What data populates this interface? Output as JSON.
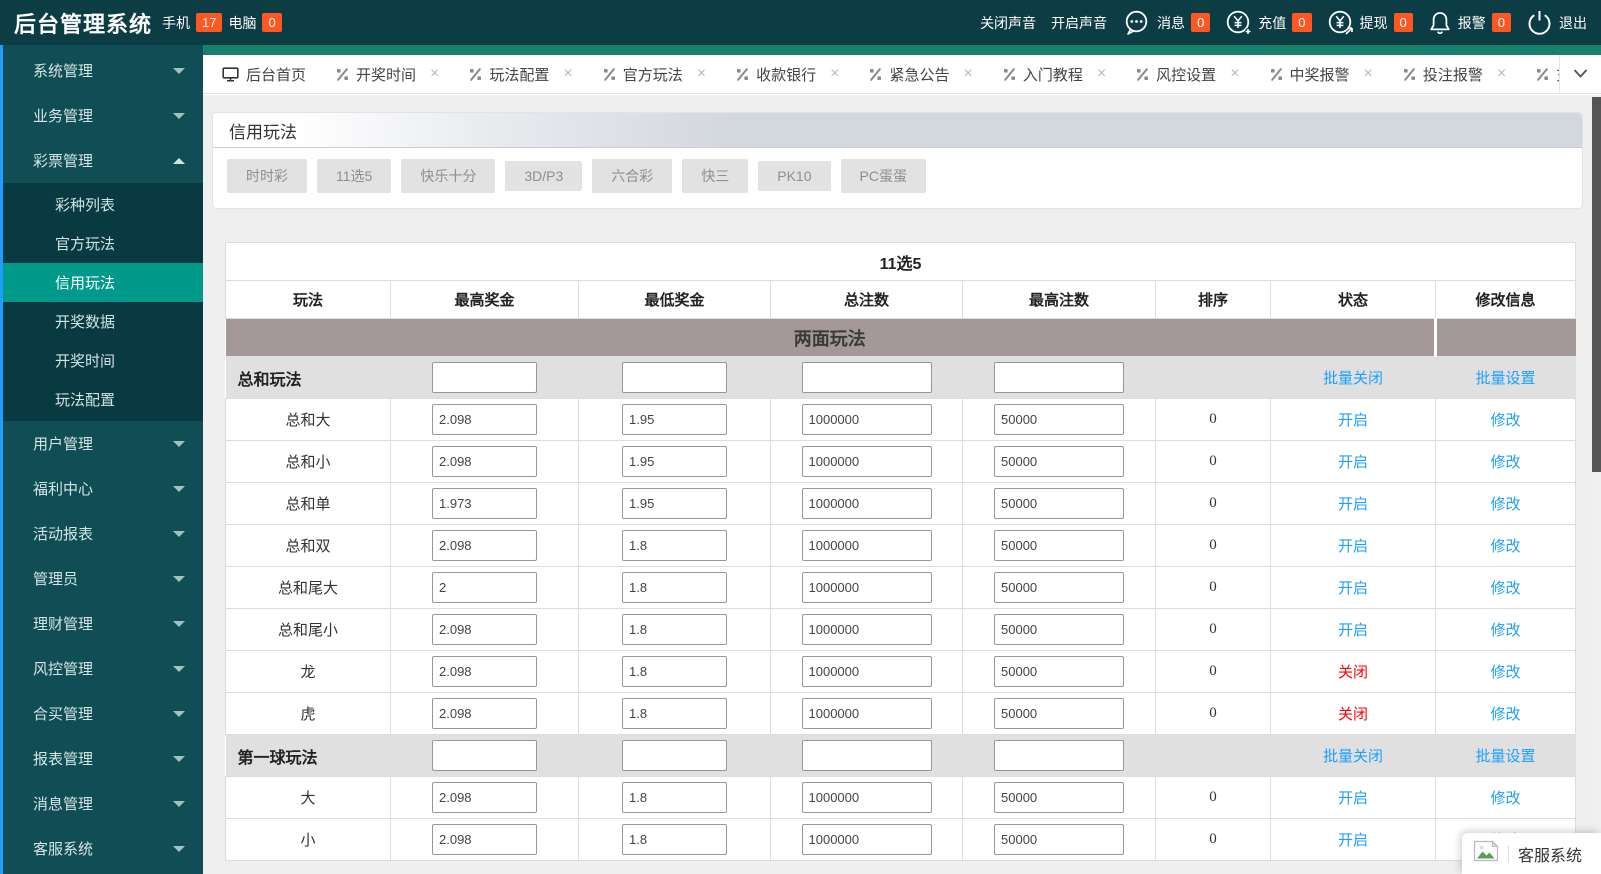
{
  "topbar": {
    "title": "后台管理系统",
    "phone_label": "手机",
    "phone_badge": "17",
    "pc_label": "电脑",
    "pc_badge": "0",
    "sound_off_label": "关闭声音",
    "sound_on_label": "开启声音",
    "message_label": "消息",
    "message_badge": "0",
    "recharge_label": "充值",
    "recharge_badge": "0",
    "withdraw_label": "提现",
    "withdraw_badge": "0",
    "alarm_label": "报警",
    "alarm_badge": "0",
    "logout_label": "退出"
  },
  "tabs": [
    {
      "label": "后台首页",
      "icon": "monitor-icon",
      "closable": false
    },
    {
      "label": "开奖时间",
      "icon": "percent-icon",
      "closable": true
    },
    {
      "label": "玩法配置",
      "icon": "percent-icon",
      "closable": true
    },
    {
      "label": "官方玩法",
      "icon": "percent-icon",
      "closable": true
    },
    {
      "label": "收款银行",
      "icon": "percent-icon",
      "closable": true
    },
    {
      "label": "紧急公告",
      "icon": "percent-icon",
      "closable": true
    },
    {
      "label": "入门教程",
      "icon": "percent-icon",
      "closable": true
    },
    {
      "label": "风控设置",
      "icon": "percent-icon",
      "closable": true
    },
    {
      "label": "中奖报警",
      "icon": "percent-icon",
      "closable": true
    },
    {
      "label": "投注报警",
      "icon": "percent-icon",
      "closable": true
    },
    {
      "label": "充值",
      "icon": "percent-icon",
      "closable": false
    }
  ],
  "sidebar": {
    "items": [
      {
        "label": "系统管理",
        "state": "collapsed"
      },
      {
        "label": "业务管理",
        "state": "collapsed"
      },
      {
        "label": "彩票管理",
        "state": "expanded",
        "children": [
          {
            "label": "彩种列表",
            "active": false
          },
          {
            "label": "官方玩法",
            "active": false
          },
          {
            "label": "信用玩法",
            "active": true
          },
          {
            "label": "开奖数据",
            "active": false
          },
          {
            "label": "开奖时间",
            "active": false
          },
          {
            "label": "玩法配置",
            "active": false
          }
        ]
      },
      {
        "label": "用户管理",
        "state": "collapsed"
      },
      {
        "label": "福利中心",
        "state": "collapsed"
      },
      {
        "label": "活动报表",
        "state": "collapsed"
      },
      {
        "label": "管理员",
        "state": "collapsed"
      },
      {
        "label": "理财管理",
        "state": "collapsed"
      },
      {
        "label": "风控管理",
        "state": "collapsed"
      },
      {
        "label": "合买管理",
        "state": "collapsed"
      },
      {
        "label": "报表管理",
        "state": "collapsed"
      },
      {
        "label": "消息管理",
        "state": "collapsed"
      },
      {
        "label": "客服系统",
        "state": "collapsed"
      }
    ]
  },
  "panel": {
    "title": "信用玩法",
    "game_tabs": [
      "时时彩",
      "11选5",
      "快乐十分",
      "3D/P3",
      "六合彩",
      "快三",
      "PK10",
      "PC蛋蛋"
    ]
  },
  "table": {
    "title": "11选5",
    "headers": [
      "玩法",
      "最高奖金",
      "最低奖金",
      "总注数",
      "最高注数",
      "排序",
      "状态",
      "修改信息"
    ],
    "rows": [
      {
        "type": "section",
        "label": "两面玩法"
      },
      {
        "type": "group",
        "label": "总和玩法",
        "inputs": [
          "",
          "",
          "",
          ""
        ],
        "batch_close": "批量关闭",
        "batch_set": "批量设置"
      },
      {
        "type": "data",
        "label": "总和大",
        "max_prize": "2.098",
        "min_prize": "1.95",
        "total_bets": "1000000",
        "max_bets": "50000",
        "sort": "0",
        "status": "开启",
        "status_state": "on",
        "edit": "修改"
      },
      {
        "type": "data",
        "label": "总和小",
        "max_prize": "2.098",
        "min_prize": "1.95",
        "total_bets": "1000000",
        "max_bets": "50000",
        "sort": "0",
        "status": "开启",
        "status_state": "on",
        "edit": "修改"
      },
      {
        "type": "data",
        "label": "总和单",
        "max_prize": "1.973",
        "min_prize": "1.95",
        "total_bets": "1000000",
        "max_bets": "50000",
        "sort": "0",
        "status": "开启",
        "status_state": "on",
        "edit": "修改"
      },
      {
        "type": "data",
        "label": "总和双",
        "max_prize": "2.098",
        "min_prize": "1.8",
        "total_bets": "1000000",
        "max_bets": "50000",
        "sort": "0",
        "status": "开启",
        "status_state": "on",
        "edit": "修改"
      },
      {
        "type": "data",
        "label": "总和尾大",
        "max_prize": "2",
        "min_prize": "1.8",
        "total_bets": "1000000",
        "max_bets": "50000",
        "sort": "0",
        "status": "开启",
        "status_state": "on",
        "edit": "修改"
      },
      {
        "type": "data",
        "label": "总和尾小",
        "max_prize": "2.098",
        "min_prize": "1.8",
        "total_bets": "1000000",
        "max_bets": "50000",
        "sort": "0",
        "status": "开启",
        "status_state": "on",
        "edit": "修改"
      },
      {
        "type": "data",
        "label": "龙",
        "max_prize": "2.098",
        "min_prize": "1.8",
        "total_bets": "1000000",
        "max_bets": "50000",
        "sort": "0",
        "status": "关闭",
        "status_state": "off",
        "edit": "修改"
      },
      {
        "type": "data",
        "label": "虎",
        "max_prize": "2.098",
        "min_prize": "1.8",
        "total_bets": "1000000",
        "max_bets": "50000",
        "sort": "0",
        "status": "关闭",
        "status_state": "off",
        "edit": "修改"
      },
      {
        "type": "group",
        "label": "第一球玩法",
        "inputs": [
          "",
          "",
          "",
          ""
        ],
        "batch_close": "批量关闭",
        "batch_set": "批量设置"
      },
      {
        "type": "data",
        "label": "大",
        "max_prize": "2.098",
        "min_prize": "1.8",
        "total_bets": "1000000",
        "max_bets": "50000",
        "sort": "0",
        "status": "开启",
        "status_state": "on",
        "edit": "修改"
      },
      {
        "type": "data",
        "label": "小",
        "max_prize": "2.098",
        "min_prize": "1.8",
        "total_bets": "1000000",
        "max_bets": "50000",
        "sort": "0",
        "status": "开启",
        "status_state": "on",
        "edit": "修改"
      }
    ]
  },
  "service_widget": {
    "label": "客服系统",
    "icon": "broken-image-icon"
  },
  "colors": {
    "topbar_bg": "#0c3c44",
    "sidebar_bg": "#114d54",
    "submenu_bg": "#0a3a41",
    "active_item": "#009a8a",
    "left_strip_blue": "#1e9fff",
    "tab_strip": "#17816d",
    "badge_orange": "#ff5722",
    "link_blue": "#1e9fff",
    "status_off_red": "#ff0000",
    "section_brown": "#a59898",
    "group_row_gray": "#e0e0e0"
  }
}
